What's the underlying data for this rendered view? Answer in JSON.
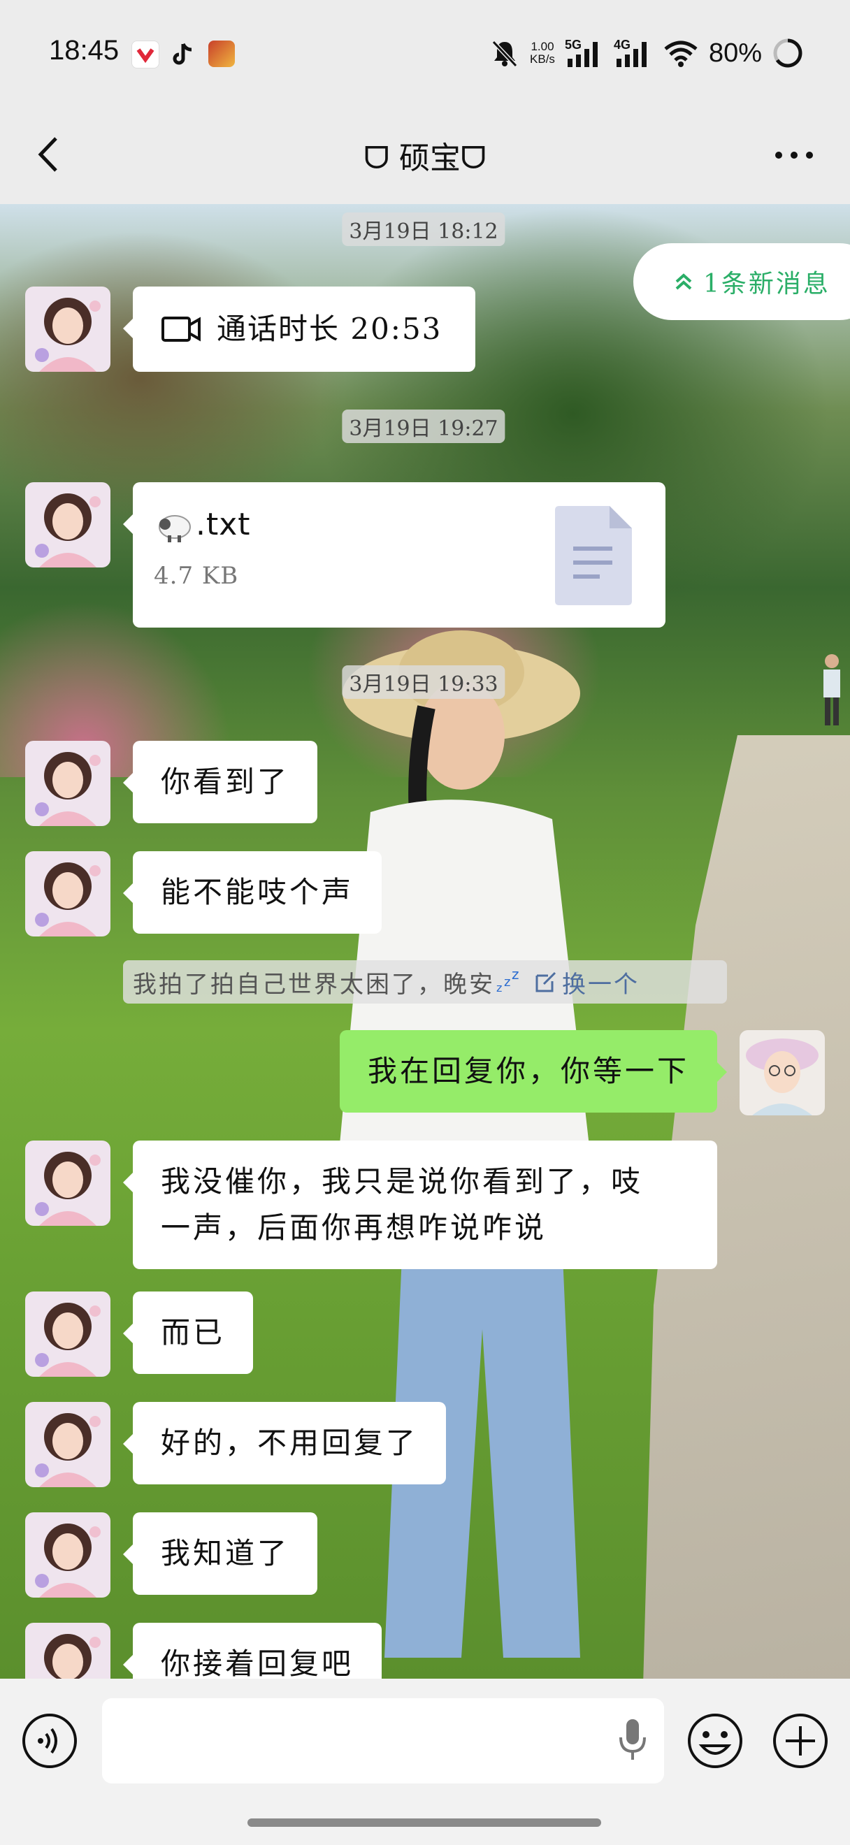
{
  "status": {
    "time": "18:45",
    "net_speed_value": "1.00",
    "net_speed_unit": "KB/s",
    "sig1": "5G",
    "sig2": "4G",
    "battery": "80%"
  },
  "header": {
    "title": "ᗜ 硕宝ᗜ"
  },
  "new_messages": "1条新消息",
  "messages": [
    {
      "type": "time",
      "text": "3月19日 18:12"
    },
    {
      "type": "call",
      "text": "通话时长 20:53"
    },
    {
      "type": "time",
      "text": "3月19日 19:27"
    },
    {
      "type": "file",
      "name": ".txt",
      "size": "4.7 KB"
    },
    {
      "type": "time",
      "text": "3月19日 19:33"
    },
    {
      "type": "text",
      "text": "你看到了"
    },
    {
      "type": "text",
      "text": "能不能吱个声"
    },
    {
      "type": "pat",
      "text": "我拍了拍自己世界太困了，晚安",
      "action": "换一个"
    },
    {
      "type": "text_out",
      "text": "我在回复你，你等一下"
    },
    {
      "type": "text",
      "line1": "我没催你，我只是说你看到了，吱",
      "line2": "一声，后面你再想咋说咋说"
    },
    {
      "type": "text",
      "text": "而已"
    },
    {
      "type": "text",
      "text": "好的，不用回复了"
    },
    {
      "type": "text",
      "text": "我知道了"
    },
    {
      "type": "text",
      "text": "你接着回复吧"
    }
  ],
  "colors": {
    "accent_green": "#95ec69",
    "new_msg_text": "#2aae67"
  }
}
